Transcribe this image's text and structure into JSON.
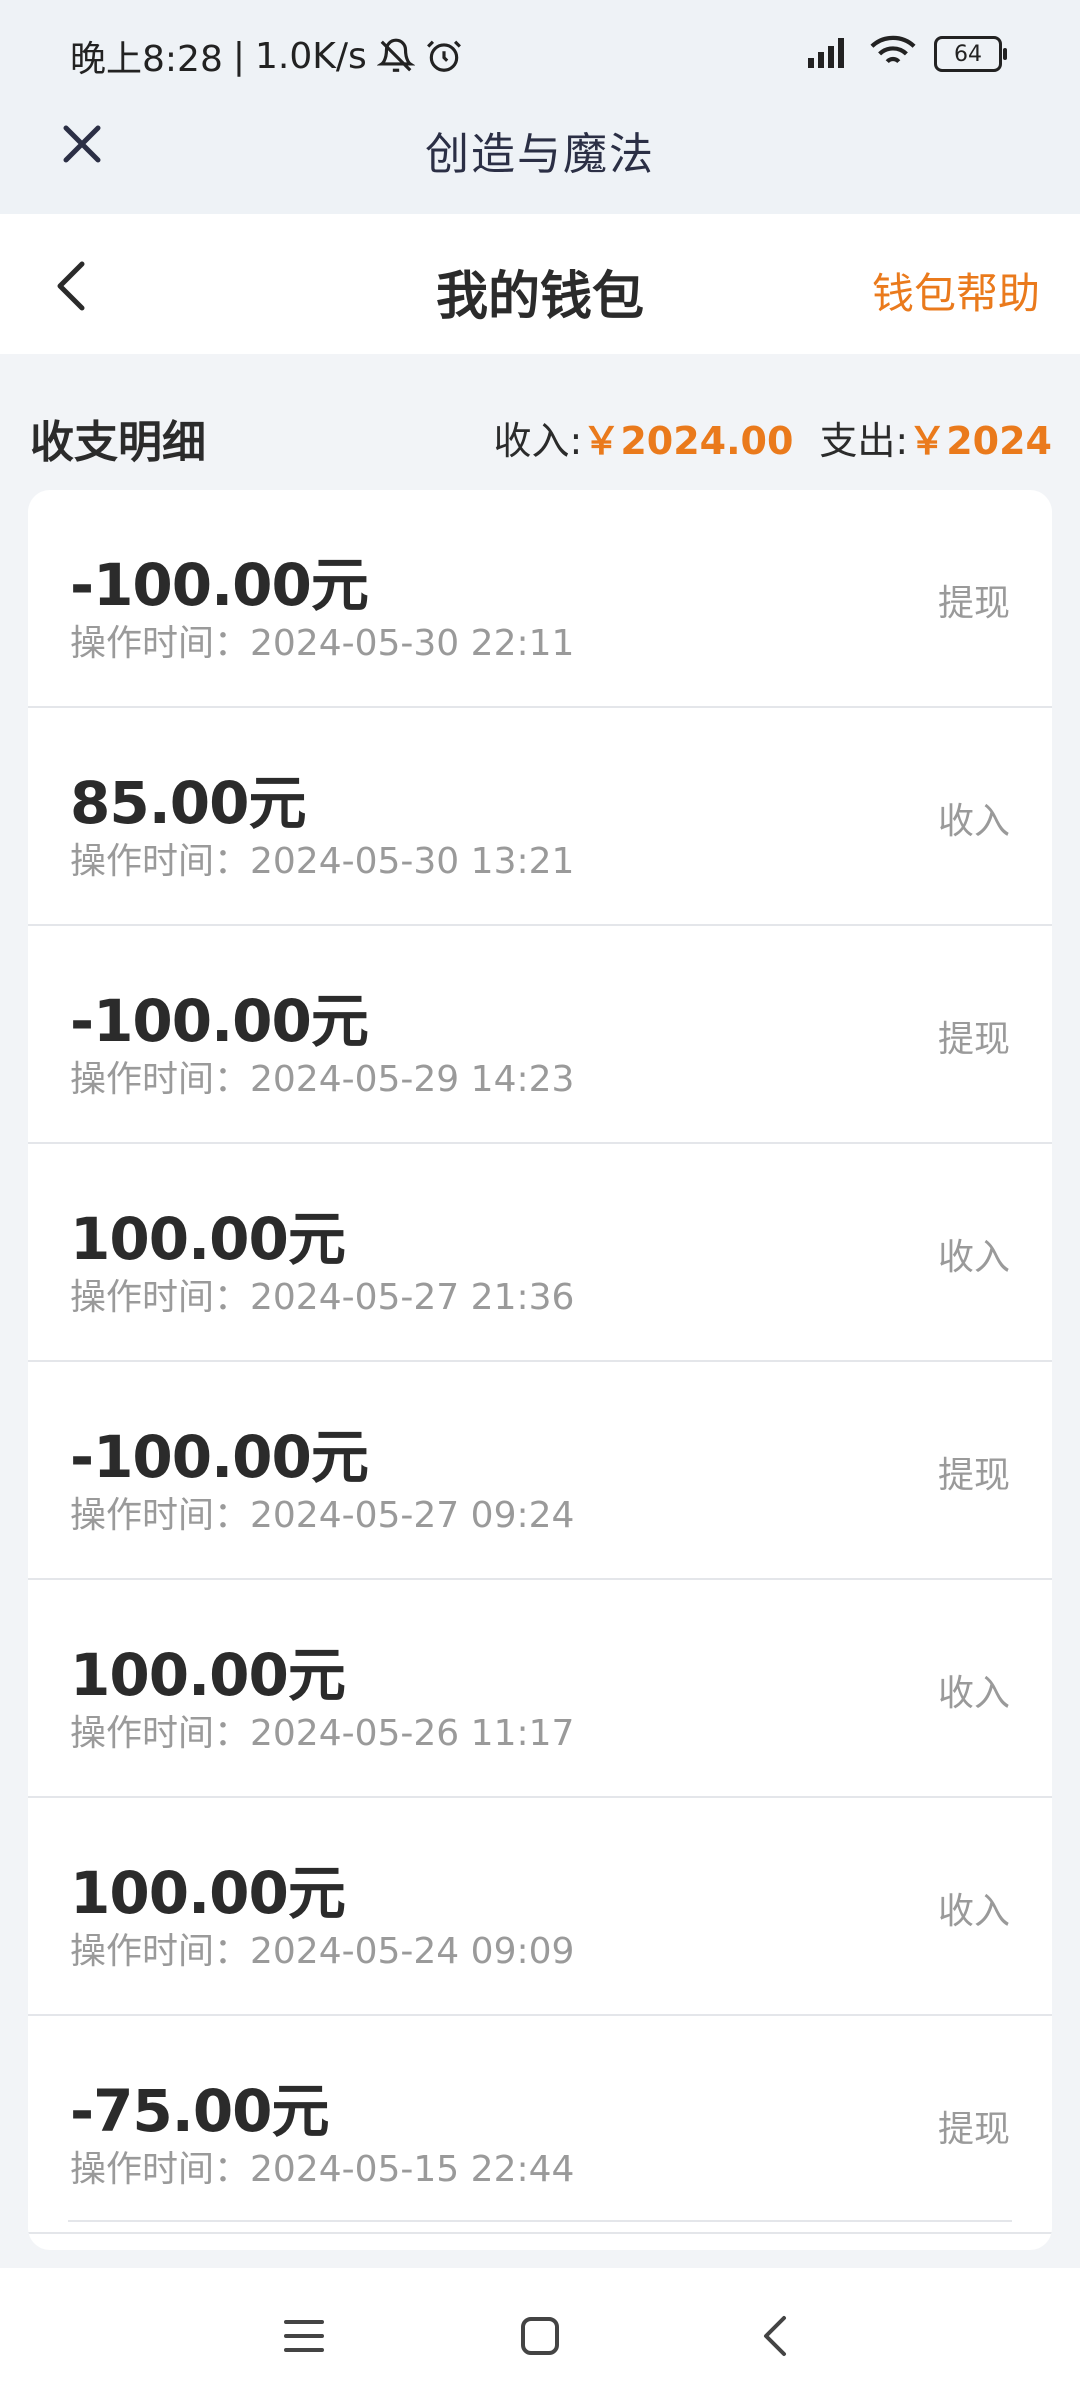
{
  "status_bar": {
    "time": "晚上8:28",
    "speed": "1.0K/s",
    "battery": "64",
    "icons": [
      "bell-off-icon",
      "alarm-icon",
      "signal-icon",
      "wifi-icon",
      "battery-icon"
    ]
  },
  "app_bar": {
    "title": "创造与魔法",
    "close_icon": "close-icon"
  },
  "header": {
    "title": "我的钱包",
    "help": "钱包帮助",
    "back_icon": "back-icon"
  },
  "summary": {
    "title": "收支明细",
    "income_label": "收入:",
    "income_value": "￥2024.00",
    "expense_label": "支出:",
    "expense_value": "￥2024"
  },
  "transactions": [
    {
      "amount": "-100.00元",
      "time": "操作时间：2024-05-30 22:11",
      "type": "提现"
    },
    {
      "amount": "85.00元",
      "time": "操作时间：2024-05-30 13:21",
      "type": "收入"
    },
    {
      "amount": "-100.00元",
      "time": "操作时间：2024-05-29 14:23",
      "type": "提现"
    },
    {
      "amount": "100.00元",
      "time": "操作时间：2024-05-27 21:36",
      "type": "收入"
    },
    {
      "amount": "-100.00元",
      "time": "操作时间：2024-05-27 09:24",
      "type": "提现"
    },
    {
      "amount": "100.00元",
      "time": "操作时间：2024-05-26 11:17",
      "type": "收入"
    },
    {
      "amount": "100.00元",
      "time": "操作时间：2024-05-24 09:09",
      "type": "收入"
    },
    {
      "amount": "-75.00元",
      "time": "操作时间：2024-05-15 22:44",
      "type": "提现"
    }
  ],
  "colors": {
    "accent": "#ea7a1c",
    "text": "#2b2b2b",
    "muted": "#9a9a9a",
    "background": "#f2f4f7"
  },
  "system_nav": [
    "menu-icon",
    "home-icon",
    "back-nav-icon"
  ]
}
